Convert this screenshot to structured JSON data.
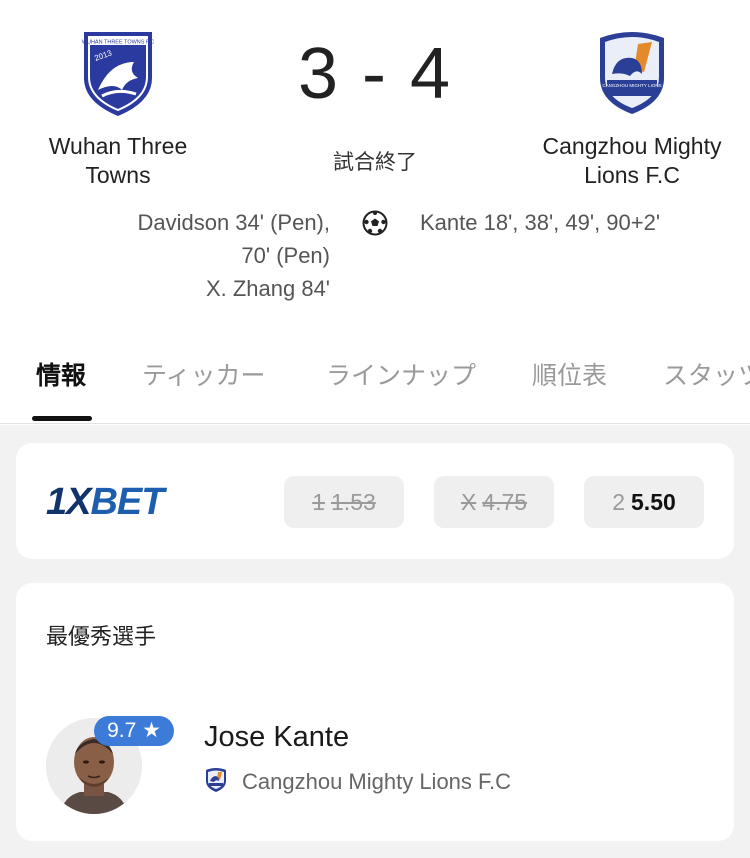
{
  "match": {
    "home": {
      "name_line1": "Wuhan Three",
      "name_line2": "Towns",
      "crest_text": "WUHAN THREE TOWNS F.C",
      "crest_year": "2013"
    },
    "away": {
      "name_line1": "Cangzhou Mighty",
      "name_line2": "Lions F.C",
      "crest_text": "CANGZHOU MIGHTY LIONS"
    },
    "score": "3 - 4",
    "status": "試合終了",
    "scorers_home": [
      "Davidson 34' (Pen),",
      "70' (Pen)",
      "X.  Zhang 84'"
    ],
    "scorers_away": [
      "Kante 18', 38', 49', 90+2'"
    ],
    "goal_icon": "soccer-ball-icon"
  },
  "tabs": [
    {
      "label": "情報",
      "active": true
    },
    {
      "label": "ティッカー",
      "active": false
    },
    {
      "label": "ラインナップ",
      "active": false
    },
    {
      "label": "順位表",
      "active": false
    },
    {
      "label": "スタッツ",
      "active": false
    }
  ],
  "odds": {
    "bookmaker_prefix": "1X",
    "bookmaker_suffix": "BET",
    "items": [
      {
        "label": "1",
        "value": "1.53",
        "struck": true
      },
      {
        "label": "X",
        "value": "4.75",
        "struck": true
      },
      {
        "label": "2",
        "value": "5.50",
        "struck": false
      }
    ]
  },
  "player_of_match": {
    "title": "最優秀選手",
    "rating": "9.7 ★",
    "name": "Jose Kante",
    "team": "Cangzhou Mighty Lions F.C"
  },
  "colors": {
    "accent_blue": "#3d7bd8",
    "bet_blue": "#1d5fae",
    "home_crest": "#2a3a9e"
  }
}
